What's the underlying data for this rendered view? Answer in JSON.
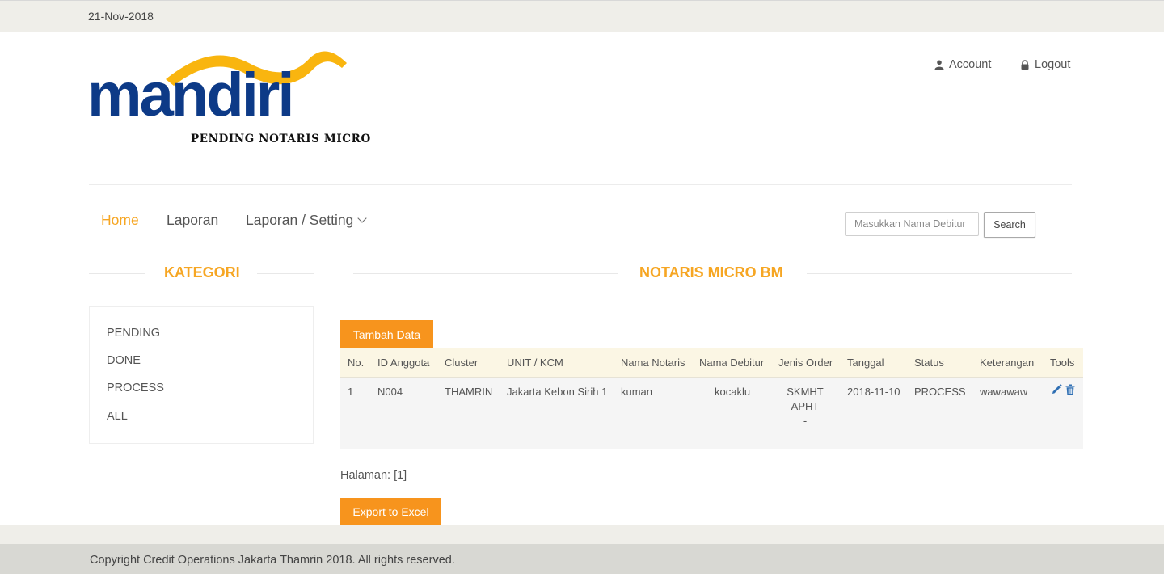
{
  "topbar": {
    "date": "21-Nov-2018"
  },
  "logo": {
    "brand": "mandiri",
    "subtitle": "PENDING NOTARIS MICRO"
  },
  "user_menu": {
    "account": "Account",
    "logout": "Logout"
  },
  "nav": {
    "home": "Home",
    "laporan": "Laporan",
    "setting": "Laporan / Setting"
  },
  "search": {
    "placeholder": "Masukkan Nama Debitur",
    "value": "",
    "button": "Search"
  },
  "kategori": {
    "title": "KATEGORI",
    "items": [
      "PENDING",
      "DONE",
      "PROCESS",
      "ALL"
    ]
  },
  "main": {
    "title": "NOTARIS MICRO BM",
    "add_button": "Tambah Data",
    "columns": [
      "No.",
      "ID Anggota",
      "Cluster",
      "UNIT / KCM",
      "Nama Notaris",
      "Nama Debitur",
      "Jenis Order",
      "Tanggal",
      "Status",
      "Keterangan",
      "Tools"
    ],
    "rows": [
      {
        "no": "1",
        "id": "N004",
        "cluster": "THAMRIN",
        "unit": "Jakarta Kebon Sirih 1",
        "notaris": "kuman",
        "debitur": "kocaklu",
        "jenis": [
          "SKMHT",
          "APHT",
          "-"
        ],
        "tanggal": "2018-11-10",
        "status": "PROCESS",
        "keterangan": "wawawaw"
      }
    ],
    "pagination": "Halaman: [1]",
    "export_button": "Export to Excel"
  },
  "footer": {
    "copyright": "Copyright Credit Operations Jakarta Thamrin 2018. All rights reserved."
  },
  "colors": {
    "accent": "#f6a623",
    "button": "#f7941d",
    "brand_blue": "#0d3a87",
    "brand_gold": "#f9b50f"
  },
  "icons": {
    "account": "user-icon",
    "logout": "lock-icon",
    "edit": "pencil-icon",
    "delete": "trash-icon"
  }
}
